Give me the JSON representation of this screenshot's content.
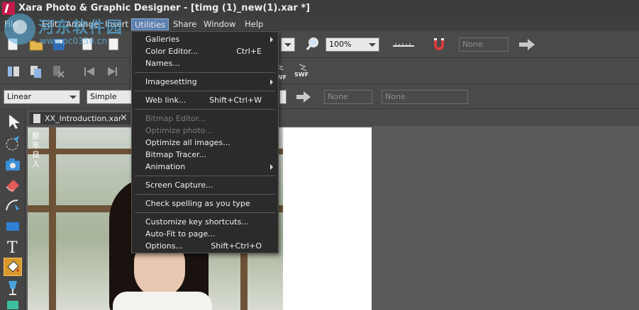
{
  "window": {
    "title": "Xara Photo & Graphic Designer - [timg (1)_new(1).xar *]"
  },
  "menubar": {
    "items": [
      {
        "label": "File"
      },
      {
        "label": "Edit"
      },
      {
        "label": "Arrange"
      },
      {
        "label": "Insert"
      },
      {
        "label": "Utilities",
        "active": true
      },
      {
        "label": "Share"
      },
      {
        "label": "Window"
      },
      {
        "label": "Help"
      }
    ]
  },
  "watermark": {
    "title": "河东软件园",
    "url": "www.pc0359.cn"
  },
  "toolbar1": {
    "zoom_value": "100%",
    "none_field": "None"
  },
  "toolbar2": {
    "swf_label": "SWF"
  },
  "toolbar3": {
    "line_type": "Linear",
    "style": "Simple",
    "none_field_1": "None",
    "none_field_2": "None"
  },
  "document": {
    "tab_label": "XX_Introduction.xar",
    "close_glyph": "×"
  },
  "photo": {
    "text_lines": [
      "那",
      "年",
      " ",
      "良",
      "人"
    ]
  },
  "dropdown": {
    "items": [
      {
        "label": "Galleries",
        "shortcut": "",
        "submenu": true,
        "disabled": false
      },
      {
        "label": "Color Editor...",
        "shortcut": "Ctrl+E",
        "submenu": false,
        "disabled": false
      },
      {
        "label": "Names...",
        "shortcut": "",
        "submenu": false,
        "disabled": false
      },
      {
        "label": "Imagesetting",
        "shortcut": "",
        "submenu": true,
        "disabled": false
      },
      {
        "label": "Web link...",
        "shortcut": "Shift+Ctrl+W",
        "submenu": false,
        "disabled": false
      },
      {
        "label": "Bitmap Editor...",
        "shortcut": "",
        "submenu": false,
        "disabled": true
      },
      {
        "label": "Optimize photo...",
        "shortcut": "",
        "submenu": false,
        "disabled": true
      },
      {
        "label": "Optimize all images...",
        "shortcut": "",
        "submenu": false,
        "disabled": false
      },
      {
        "label": "Bitmap Tracer...",
        "shortcut": "",
        "submenu": false,
        "disabled": false
      },
      {
        "label": "Animation",
        "shortcut": "",
        "submenu": true,
        "disabled": false
      },
      {
        "label": "Screen Capture...",
        "shortcut": "",
        "submenu": false,
        "disabled": false
      },
      {
        "label": "Check spelling as you type",
        "shortcut": "",
        "submenu": false,
        "disabled": false
      },
      {
        "label": "Customize key shortcuts...",
        "shortcut": "",
        "submenu": false,
        "disabled": false
      },
      {
        "label": "Auto-Fit to page...",
        "shortcut": "",
        "submenu": false,
        "disabled": false
      },
      {
        "label": "Options...",
        "shortcut": "Shift+Ctrl+O",
        "submenu": false,
        "disabled": false
      }
    ]
  },
  "colors": {
    "menu_active": "#5b7fb0",
    "tool_active": "#d99a2b",
    "logo": "#c21b4a"
  }
}
